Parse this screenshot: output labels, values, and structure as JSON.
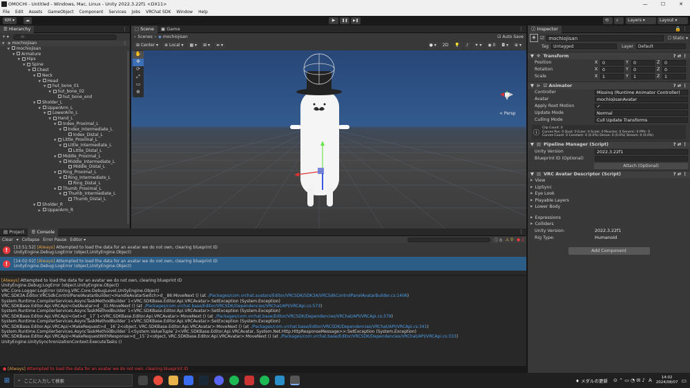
{
  "window": {
    "title": "OMOCHI - Untitled - Windows, Mac, Linux - Unity 2022.3.22f1 <DX11>",
    "controls": [
      "—",
      "☐",
      "✕"
    ]
  },
  "menu": [
    "File",
    "Edit",
    "Assets",
    "GameObject",
    "Component",
    "Services",
    "Jobs",
    "VRChat SDK",
    "Window",
    "Help"
  ],
  "toolbar": {
    "account": "KM ▾",
    "cloud": "☁",
    "play": "▶",
    "pause": "❚❚",
    "step": "▶❚",
    "layers": "Layers",
    "layout": "Layout"
  },
  "hierarchy": {
    "tab": "Hierarchy",
    "add": "+ ▾",
    "search_placeholder": "All",
    "scene": "mochiojisan",
    "items": [
      {
        "label": "mochiojisan",
        "indent": 1,
        "arrow": "▼"
      },
      {
        "label": "Armature",
        "indent": 2,
        "arrow": "▼"
      },
      {
        "label": "Hips",
        "indent": 3,
        "arrow": "▼"
      },
      {
        "label": "Spine",
        "indent": 4,
        "arrow": "▼"
      },
      {
        "label": "Chest",
        "indent": 5,
        "arrow": "▼"
      },
      {
        "label": "Neck",
        "indent": 6,
        "arrow": "▼"
      },
      {
        "label": "Head",
        "indent": 7,
        "arrow": "▼"
      },
      {
        "label": "hut_bone_01",
        "indent": 8,
        "arrow": "▼"
      },
      {
        "label": "hut_bone_02",
        "indent": 9,
        "arrow": "▼"
      },
      {
        "label": "hut_bone_end",
        "indent": 10,
        "arrow": ""
      },
      {
        "label": "Sholder_L",
        "indent": 6,
        "arrow": "▼"
      },
      {
        "label": "UpperArm_L",
        "indent": 7,
        "arrow": "▼"
      },
      {
        "label": "LowerArm_L",
        "indent": 8,
        "arrow": "▼"
      },
      {
        "label": "Hand_L",
        "indent": 9,
        "arrow": "▼"
      },
      {
        "label": "Index_Proximal_L",
        "indent": 10,
        "arrow": "▼"
      },
      {
        "label": "Index_Intermediate_L",
        "indent": 11,
        "arrow": "▼"
      },
      {
        "label": "Index_Distal_L",
        "indent": 12,
        "arrow": ""
      },
      {
        "label": "Little_Proximal_L",
        "indent": 10,
        "arrow": "▼"
      },
      {
        "label": "Little_Intermediate_L",
        "indent": 11,
        "arrow": "▼"
      },
      {
        "label": "Little_Distal_L",
        "indent": 12,
        "arrow": ""
      },
      {
        "label": "Middle_Proximal_L",
        "indent": 10,
        "arrow": "▼"
      },
      {
        "label": "Middle_Intermediate_L",
        "indent": 11,
        "arrow": "▼"
      },
      {
        "label": "Middle_Distal_L",
        "indent": 12,
        "arrow": ""
      },
      {
        "label": "Ring_Proximal_L",
        "indent": 10,
        "arrow": "▼"
      },
      {
        "label": "Ring_Intermediate_L",
        "indent": 11,
        "arrow": "▼"
      },
      {
        "label": "Ring_Distal_L",
        "indent": 12,
        "arrow": ""
      },
      {
        "label": "Thumb_Proximal_L",
        "indent": 10,
        "arrow": "▼"
      },
      {
        "label": "Thumb_Intermediate_L",
        "indent": 11,
        "arrow": "▼"
      },
      {
        "label": "Thumb_Distal_L",
        "indent": 12,
        "arrow": ""
      },
      {
        "label": "Sholder_R",
        "indent": 6,
        "arrow": "▼"
      },
      {
        "label": "UpperArm_R",
        "indent": 7,
        "arrow": "▶"
      }
    ]
  },
  "scene": {
    "tabs": [
      "Scene",
      "Game"
    ],
    "breadcrumb_root": "Scenes",
    "breadcrumb_obj": "mochiojisan",
    "autosave": "Auto Save",
    "pivot": "Center",
    "space": "Local",
    "mode2d": "2D",
    "persp": "< Persp"
  },
  "console": {
    "tabs": [
      "Project",
      "Console"
    ],
    "toolbar": [
      "Clear",
      "▾",
      "Collapse",
      "Error Pause",
      "Editor ▾"
    ],
    "counts": {
      "info": "0",
      "warn": "0",
      "error": "2"
    },
    "entries": [
      {
        "time": "[13:51:52]",
        "tag": "[Always]",
        "msg": "Attempted to load the data for an avatar we do not own, clearing blueprint ID",
        "line2": "UnityEngine.Debug:LogError (object,UnityEngine.Object)"
      },
      {
        "time": "[14:02:02]",
        "tag": "[Always]",
        "msg": "Attempted to load the data for an avatar we do not own, clearing blueprint ID",
        "line2": "UnityEngine.Debug:LogError (object,UnityEngine.Object)"
      }
    ],
    "detail": [
      {
        "pre": "",
        "tag": "[Always]",
        "text": " Attempted to load the data for an avatar we do not own, clearing blueprint ID",
        "link": "",
        "post": ""
      },
      {
        "pre": "UnityEngine.Debug:LogError (object,UnityEngine.Object)",
        "tag": "",
        "text": "",
        "link": "",
        "post": ""
      },
      {
        "pre": "VRC.Core.Logger:LogError (string,VRC.Core.DebugLevel,UnityEngine.Object)",
        "tag": "",
        "text": "",
        "link": "",
        "post": ""
      },
      {
        "pre": "VRC.SDK3A.Editor.VRCSdkControlPanelAvatarBuilder/<HandleAvatarSwitch>d__86:MoveNext () (at ",
        "tag": "",
        "text": "",
        "link": "./Packages/com.vrchat.avatars/Editor/VRCSDK/SDK3A/VRCSdkControlPanelAvatarBuilder.cs:1406",
        "post": ")"
      },
      {
        "pre": "System.Runtime.CompilerServices.AsyncTaskMethodBuilder`1<VRC.SDKBase.Editor.Api.VRCAvatar>:SetException (System.Exception)",
        "tag": "",
        "text": "",
        "link": "",
        "post": ""
      },
      {
        "pre": "VRC.SDKBase.Editor.Api.VRCApi/<GetAvatar>d__31:MoveNext () (at ",
        "tag": "",
        "text": "",
        "link": "./Packages/com.vrchat.base/Editor/VRCSDK/Dependencies/VRChat/API/VRCApi.cs:573",
        "post": ")"
      },
      {
        "pre": "System.Runtime.CompilerServices.AsyncTaskMethodBuilder`1<VRC.SDKBase.Editor.Api.VRCAvatar>:SetException (System.Exception)",
        "tag": "",
        "text": "",
        "link": "",
        "post": ""
      },
      {
        "pre": "VRC.SDKBase.Editor.Api.VRCApi/<Get>d__17`1<VRC.SDKBase.Editor.Api.VRCAvatar>:MoveNext () (at ",
        "tag": "",
        "text": "",
        "link": "./Packages/com.vrchat.base/Editor/VRCSDK/Dependencies/VRChat/API/VRCApi.cs:379",
        "post": ")"
      },
      {
        "pre": "System.Runtime.CompilerServices.AsyncTaskMethodBuilder`1<VRC.SDKBase.Editor.Api.VRCAvatar>:SetException (System.Exception)",
        "tag": "",
        "text": "",
        "link": "",
        "post": ""
      },
      {
        "pre": "VRC.SDKBase.Editor.Api.VRCApi/<MakeRequest>d__16`2<object, VRC.SDKBase.Editor.Api.VRCAvatar>:MoveNext () (at ",
        "tag": "",
        "text": "",
        "link": "./Packages/com.vrchat.base/Editor/VRCSDK/Dependencies/VRChat/API/VRCApi.cs:341",
        "post": ")"
      },
      {
        "pre": "System.Runtime.CompilerServices.AsyncTaskMethodBuilder`1<System.ValueTuple`2<VRC.SDKBase.Editor.Api.VRCAvatar, System.Net.Http.HttpResponseMessage>>:SetException (System.Exception)",
        "tag": "",
        "text": "",
        "link": "",
        "post": ""
      },
      {
        "pre": "VRC.SDKBase.Editor.Api.VRCApi/<MakeRequestWithResponse>d__15`2<object, VRC.SDKBase.Editor.Api.VRCAvatar>:MoveNext () (at ",
        "tag": "",
        "text": "",
        "link": "./Packages/com.vrchat.base/Editor/VRCSDK/Dependencies/VRChat/API/VRCApi.cs:333",
        "post": ")"
      },
      {
        "pre": "UnityEngine.UnitySynchronizationContext:ExecuteTasks ()",
        "tag": "",
        "text": "",
        "link": "",
        "post": ""
      }
    ]
  },
  "status": {
    "tag": "[Always]",
    "msg": " Attempted to load the data for an avatar we do not own, clearing blueprint ID"
  },
  "inspector": {
    "tab": "Inspector",
    "object_name": "mochiojisan",
    "static": "Static",
    "tag_label": "Tag",
    "tag_value": "Untagged",
    "layer_label": "Layer",
    "layer_value": "Default",
    "transform": {
      "title": "Transform",
      "rows": [
        {
          "label": "Position",
          "x": "0",
          "y": "0",
          "z": "0"
        },
        {
          "label": "Rotation",
          "x": "0",
          "y": "0",
          "z": "0"
        },
        {
          "label": "Scale",
          "x": "1",
          "y": "1",
          "z": "1"
        }
      ]
    },
    "animator": {
      "title": "Animator",
      "rows": [
        {
          "label": "Controller",
          "value": "Missing (Runtime Animator Controller)"
        },
        {
          "label": "Avatar",
          "value": "mochiojisanAvatar"
        },
        {
          "label": "Apply Root Motion",
          "value": "✓"
        },
        {
          "label": "Update Mode",
          "value": "Normal"
        },
        {
          "label": "Culling Mode",
          "value": "Cull Update Transforms"
        }
      ],
      "info": [
        "Clip Count: 0",
        "Curves Pos: 0 Quat: 0 Euler: 0 Scale: 0 Muscles: 0 Generic: 0 PPtr: 0",
        "Curves Count: 0 Constant: 0 (0.0%) Dense: 0 (0.0%) Stream: 0 (0.0%)"
      ]
    },
    "pipeline": {
      "title": "Pipeline Manager (Script)",
      "rows": [
        {
          "label": "Unity Version",
          "value": "2022.3.22f1"
        },
        {
          "label": "Blueprint ID (Optional)",
          "value": ""
        }
      ],
      "attach": "Attach (Optional)"
    },
    "descriptor": {
      "title": "VRC Avatar Descriptor (Script)",
      "sections": [
        "View",
        "LipSync",
        "Eye Look",
        "Playable Layers",
        "Lower Body"
      ],
      "sections2": [
        "Expressions",
        "Colliders"
      ],
      "rows": [
        {
          "label": "Unity Version:",
          "value": "2022.3.22f1"
        },
        {
          "label": "Rig Type:",
          "value": "Humanoid"
        }
      ]
    },
    "add_component": "Add Component"
  },
  "taskbar": {
    "search_placeholder": "ここに入力して検索",
    "notification": "メダルの更新",
    "time": "14:02",
    "date": "2024/08/07",
    "ime": "A"
  }
}
